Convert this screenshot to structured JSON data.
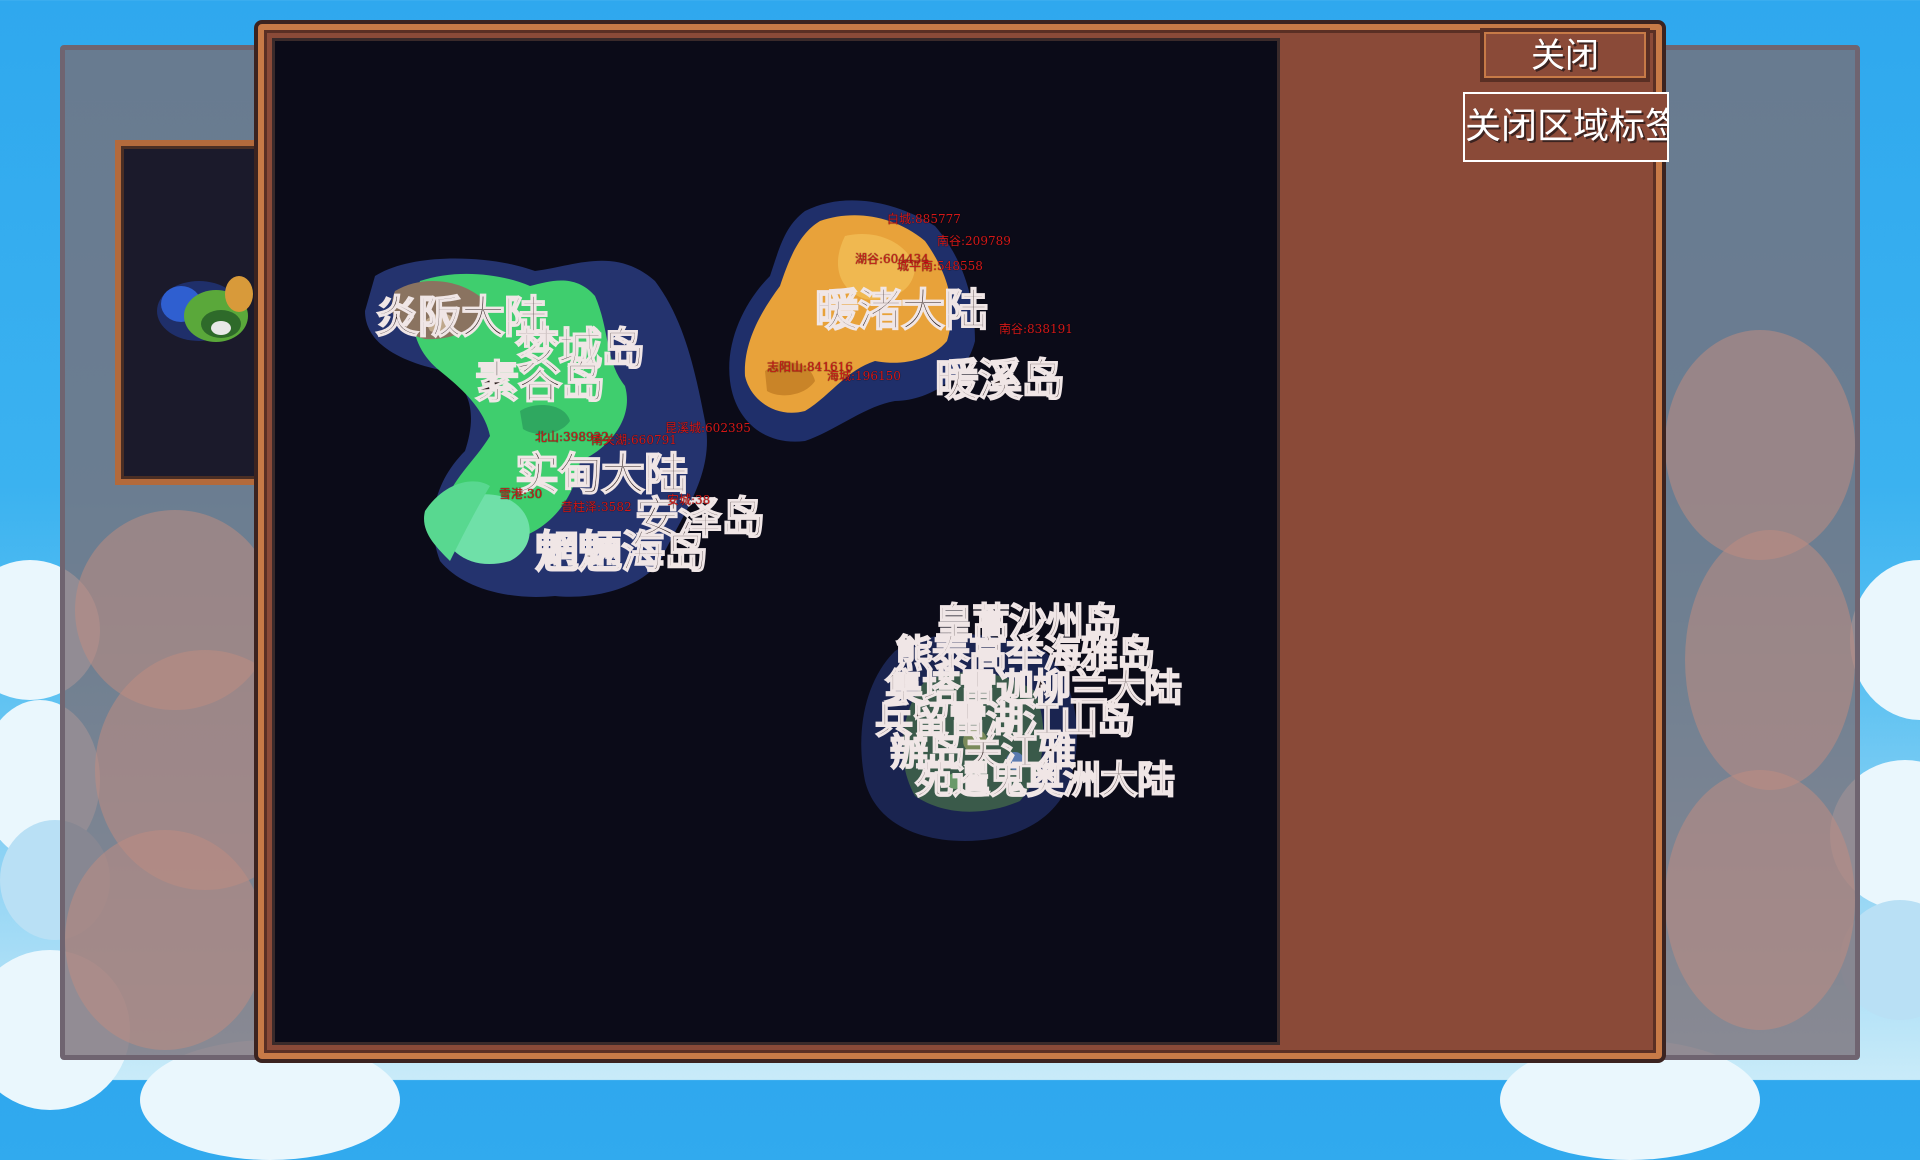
{
  "buttons": {
    "close": "关闭",
    "close_region_labels": "关闭区域标签"
  },
  "region_labels": [
    {
      "id": "yanban",
      "text": "炎阪大陆"
    },
    {
      "id": "mengcheng",
      "text": "梦城岛"
    },
    {
      "id": "sugu",
      "text": "素谷岛"
    },
    {
      "id": "nuanzhu",
      "text": "暖渚大陆"
    },
    {
      "id": "nuanxi",
      "text": "暖溪岛"
    },
    {
      "id": "shidian",
      "text": "实甸大陆"
    },
    {
      "id": "anze",
      "text": "安泽岛"
    },
    {
      "id": "moxuan",
      "text": "魍魎海岛"
    },
    {
      "id": "cluster1",
      "text": "皇蒿沙州岛"
    },
    {
      "id": "cluster2",
      "text": "熊泰高举海雅岛"
    },
    {
      "id": "cluster3",
      "text": "集塔雷迦柳兰大陆"
    },
    {
      "id": "cluster4",
      "text": "兵留雷湖江山岛"
    },
    {
      "id": "cluster5",
      "text": "辦岛关江雅"
    },
    {
      "id": "cluster6",
      "text": "苑暹鬼奥洲大陆"
    }
  ],
  "city_labels": [
    {
      "text": "白城:885777"
    },
    {
      "text": "南谷:209789"
    },
    {
      "text": "湖谷:604434"
    },
    {
      "text": "城平南:548558"
    },
    {
      "text": "南谷:838191"
    },
    {
      "text": "志阳山:841616"
    },
    {
      "text": "海城:196150"
    },
    {
      "text": "北山:398922"
    },
    {
      "text": "南关湖:660791"
    },
    {
      "text": "昆溪城:602395"
    },
    {
      "text": "雪港:30"
    },
    {
      "text": "昔柱泽:3582"
    },
    {
      "text": "安城:38"
    }
  ],
  "colors": {
    "frame": "#8a4a38",
    "frame_border": "#c77a47",
    "map_bg": "#0b0b18",
    "ocean_shallow": "#1f2f6a",
    "grassland": "#3fce6e",
    "desert": "#e8a23a",
    "label_red": "#d41818"
  }
}
